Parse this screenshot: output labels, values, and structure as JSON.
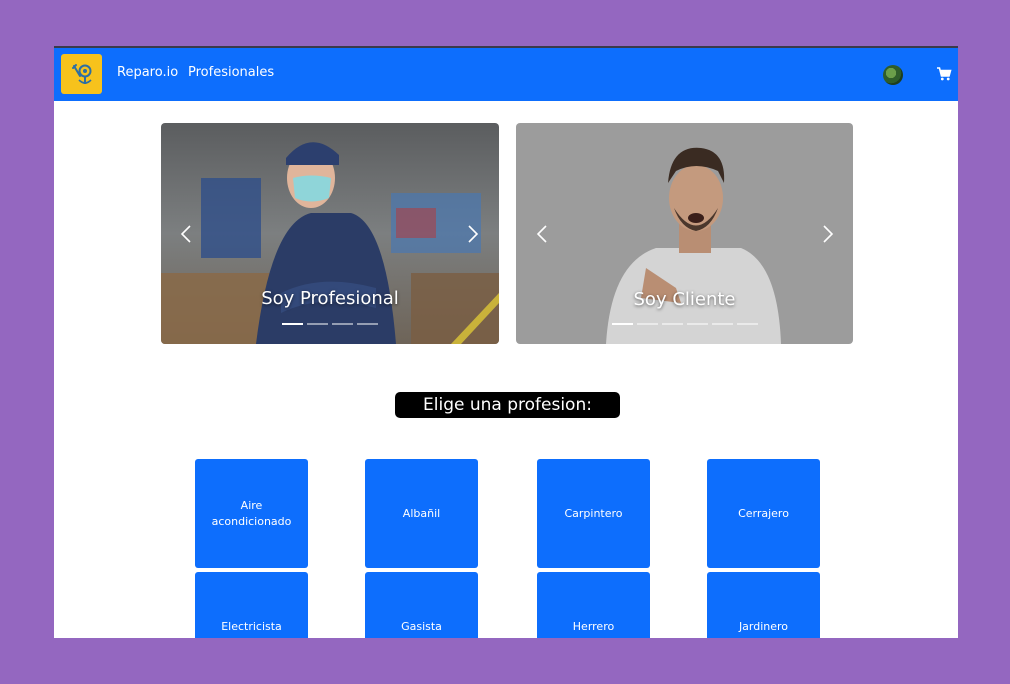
{
  "navbar": {
    "brand": "Reparo.io",
    "link": "Profesionales",
    "icons": {
      "logo": "wrench-location-icon",
      "avatar": "avatar",
      "cart": "cart-icon"
    },
    "colors": {
      "bar": "#0d6efd",
      "logo_bg": "#f7c21c"
    }
  },
  "carousel_pro": {
    "caption": "Soy Profesional",
    "slides": 4,
    "active": 0
  },
  "carousel_cli": {
    "caption": "Soy Cliente",
    "slides": 6,
    "active": 0
  },
  "heading": "Elige una profesion:",
  "professions": [
    "Aire acondicionado",
    "Albañil",
    "Carpintero",
    "Cerrajero",
    "Electricista",
    "Gasista",
    "Herrero",
    "Jardinero"
  ]
}
